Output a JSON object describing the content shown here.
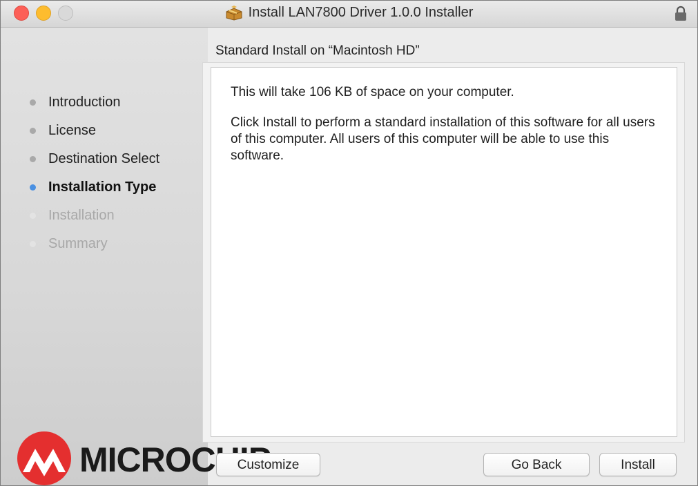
{
  "window": {
    "title": "Install LAN7800 Driver 1.0.0 Installer",
    "traffic_lights": {
      "close": "#fc5f57",
      "minimize": "#fdbc2e",
      "zoom": "#d9d9d9"
    }
  },
  "sidebar": {
    "steps": [
      {
        "label": "Introduction",
        "state": "done"
      },
      {
        "label": "License",
        "state": "done"
      },
      {
        "label": "Destination Select",
        "state": "done"
      },
      {
        "label": "Installation Type",
        "state": "current"
      },
      {
        "label": "Installation",
        "state": "future"
      },
      {
        "label": "Summary",
        "state": "future"
      }
    ],
    "logo": {
      "text": "MICROCHIP",
      "mark_color": "#e42f2f"
    }
  },
  "main": {
    "heading": "Standard Install on “Macintosh HD”",
    "paragraphs": [
      "This will take 106 KB of space on your computer.",
      "Click Install to perform a standard installation of this software for all users of this computer. All users of this computer will be able to use this software."
    ]
  },
  "buttons": {
    "customize": "Customize",
    "go_back": "Go Back",
    "install": "Install"
  },
  "icons": {
    "title": "package-icon",
    "lock": "lock-icon"
  },
  "colors": {
    "current_step_dot": "#4a90e2",
    "done_step_dot": "#a9a9a9"
  }
}
